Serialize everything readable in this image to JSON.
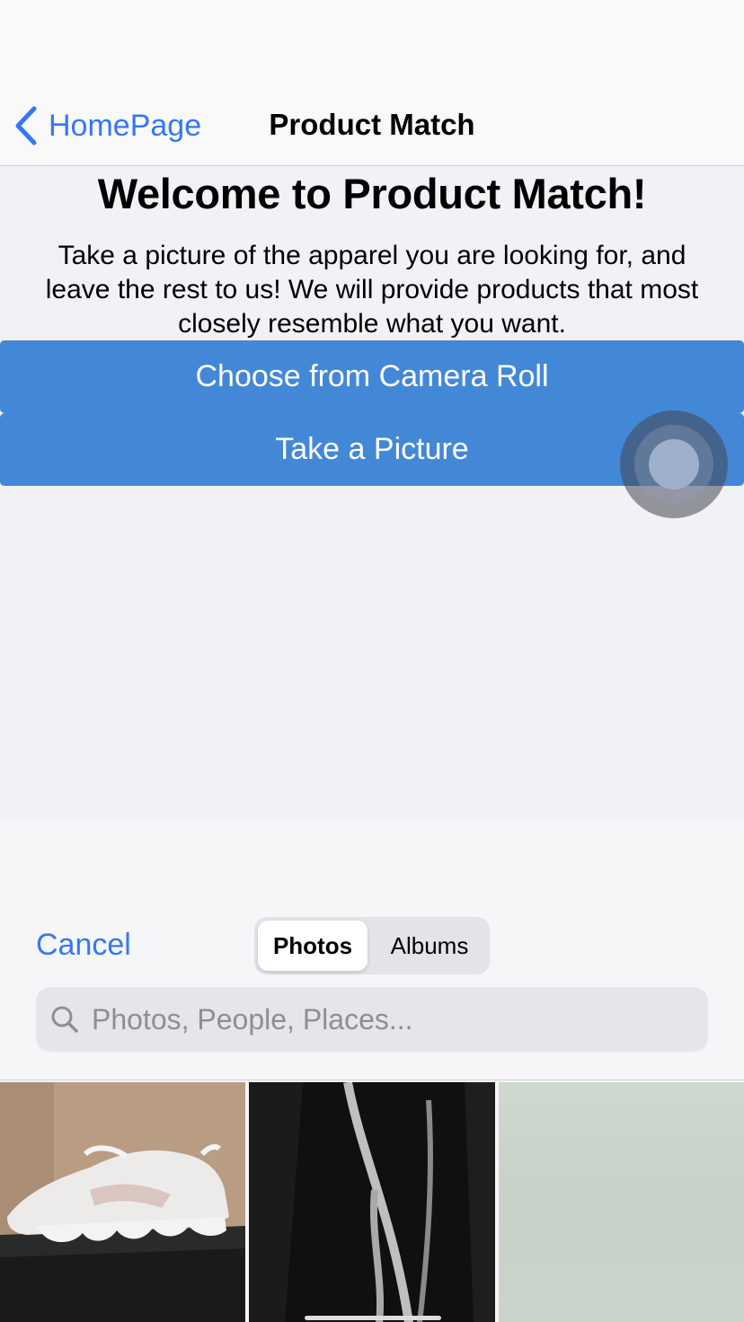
{
  "nav": {
    "back_label": "HomePage",
    "title": "Product Match"
  },
  "main": {
    "welcome": "Welcome to Product Match!",
    "intro_lines": [
      "Take a picture of the apparel you are looking for, and",
      "leave the rest to us! We will provide products that most",
      "closely resemble what you want."
    ],
    "camera_roll_label": "Choose from Camera Roll",
    "take_picture_label": "Take a Picture"
  },
  "picker": {
    "cancel_label": "Cancel",
    "tabs": [
      {
        "label": "Photos",
        "selected": true
      },
      {
        "label": "Albums",
        "selected": false
      }
    ],
    "search_placeholder": "Photos, People, Places..."
  },
  "colors": {
    "accent": "#3478f6",
    "button_bg": "#4388d6"
  }
}
